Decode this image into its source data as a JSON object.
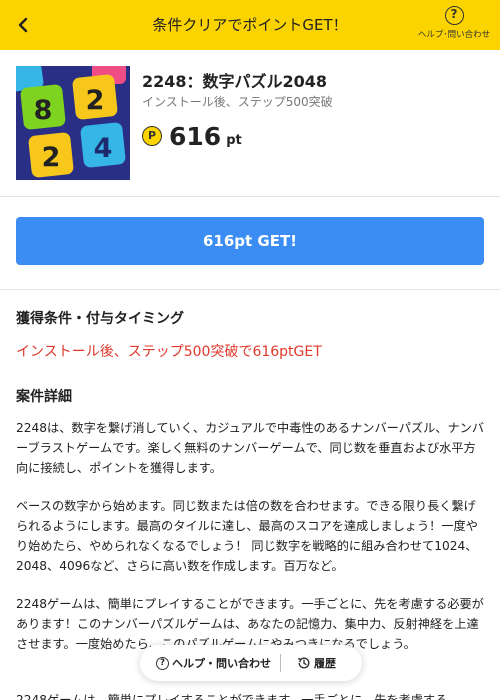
{
  "header": {
    "title": "条件クリアでポイントGET！",
    "help_icon_glyph": "?",
    "help_label": "ヘルプ･問い合わせ",
    "background_color": "#fbd400"
  },
  "app": {
    "name": "2248：数字パズル2048",
    "subtitle": "インストール後、ステップ500突破",
    "icon_digits": [
      "8",
      "2",
      "2",
      "4"
    ],
    "points_icon_glyph": "P",
    "points_value": "616",
    "points_unit": "pt"
  },
  "get_button": {
    "label": "616pt GET!",
    "color": "#3b8cf3"
  },
  "conditions": {
    "title": "獲得条件・付与タイミング",
    "text": "インストール後、ステップ500突破で616ptGET",
    "text_color": "#e0382b"
  },
  "details": {
    "title": "案件詳細",
    "paragraphs": [
      "2248は、数字を繋げ消していく、カジュアルで中毒性のあるナンバーパズル、ナンバーブラストゲームです。楽しく無料のナンバーゲームで、同じ数を垂直および水平方向に接続し、ポイントを獲得します。",
      "ベースの数字から始めます。同じ数または倍の数を合わせます。できる限り長く繋げられるようにします。最高のタイルに達し、最高のスコアを達成しましょう！一度やり始めたら、やめられなくなるでしょう！ 同じ数字を戦略的に組み合わせて1024、2048、4096など、さらに高い数を作成します。百万など。",
      "2248ゲームは、簡単にプレイすることができます。一手ごとに、先を考慮する必要があります！このナンバーパズルゲームは、あなたの記憶力、集中力、反射神経を上達させます。一度始めたら、このパズルゲームにやみつきになるでしょう。",
      "2248ゲームは、簡単にプレイすることができます。一手ごとに、先を考慮する"
    ]
  },
  "floating_bar": {
    "help_icon_glyph": "?",
    "help_label": "ヘルプ・問い合わせ",
    "history_label": "履歴"
  }
}
